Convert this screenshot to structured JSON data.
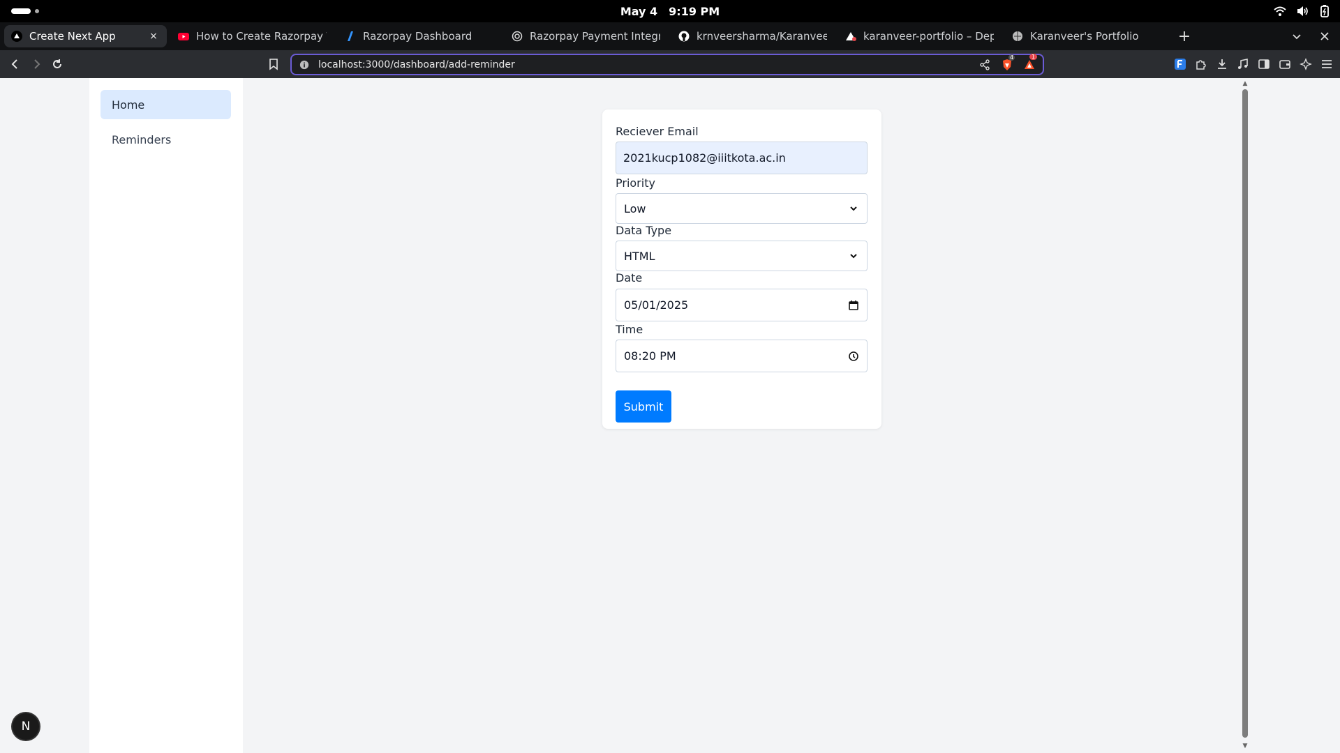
{
  "system_bar": {
    "date": "May 4",
    "time": "9:19 PM",
    "tray_icons": [
      "wifi-icon",
      "volume-icon",
      "battery-icon"
    ]
  },
  "tabs": [
    {
      "title": "Create Next App",
      "favicon": "vercel-triangle-icon",
      "active": true
    },
    {
      "title": "How to Create Razorpay Test",
      "favicon": "youtube-icon",
      "active": false
    },
    {
      "title": "Razorpay Dashboard",
      "favicon": "razorpay-icon",
      "active": false
    },
    {
      "title": "Razorpay Payment Integratic",
      "favicon": "globe-icon",
      "active": false
    },
    {
      "title": "krnveersharma/Karanveer-P",
      "favicon": "github-icon",
      "active": false
    },
    {
      "title": "karanveer-portfolio – Deploy",
      "favicon": "vercel-triangle-icon",
      "active": false
    },
    {
      "title": "Karanveer's Portfolio",
      "favicon": "globe-icon",
      "active": false
    }
  ],
  "tab_close_label": "×",
  "new_tab_label": "+",
  "address_bar": {
    "url": "localhost:3000/dashboard/add-reminder",
    "shields_badge": "4",
    "alert_badge": "1"
  },
  "sidebar": {
    "items": [
      {
        "label": "Home",
        "active": true
      },
      {
        "label": "Reminders",
        "active": false
      }
    ]
  },
  "form": {
    "email": {
      "label": "Reciever Email",
      "value": "2021kucp1082@iiitkota.ac.in"
    },
    "priority": {
      "label": "Priority",
      "value": "Low"
    },
    "data_type": {
      "label": "Data Type",
      "value": "HTML"
    },
    "date": {
      "label": "Date",
      "value": "05/01/2025"
    },
    "time": {
      "label": "Time",
      "value": "08:20 PM"
    },
    "submit_label": "Submit"
  },
  "next_badge": "N",
  "colors": {
    "accent_button": "#007bff",
    "active_sidebar": "#dbeafe",
    "page_bg": "#f3f4f6",
    "url_border": "#6b5cd6"
  }
}
